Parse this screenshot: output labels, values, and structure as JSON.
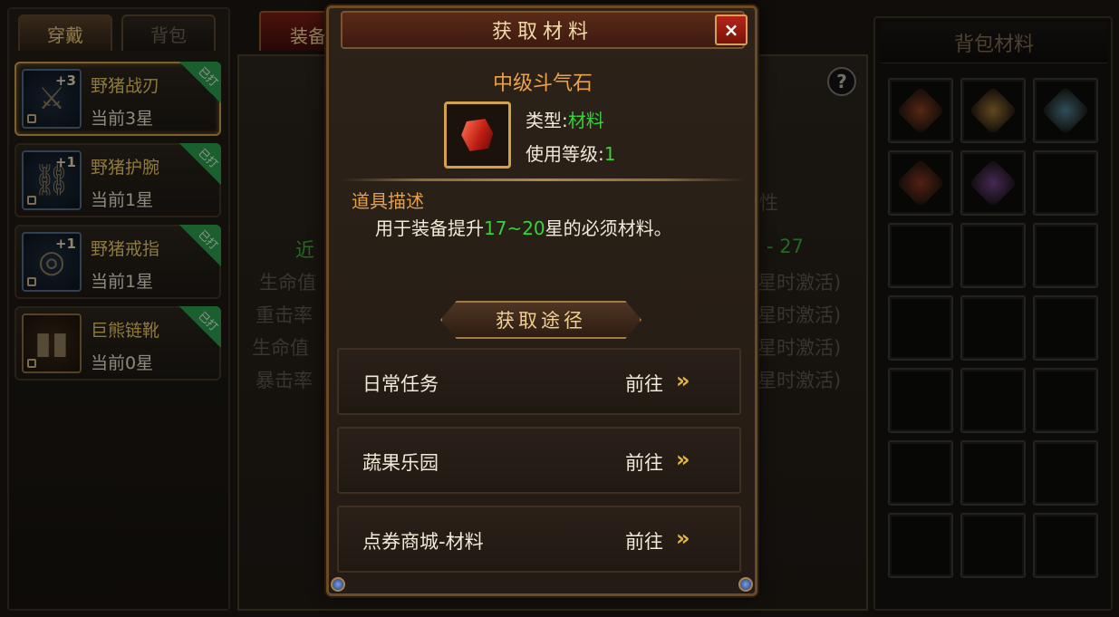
{
  "left_panel": {
    "tabs": [
      {
        "label": "穿戴"
      },
      {
        "label": "背包"
      }
    ],
    "items": [
      {
        "name": "野猪战刃",
        "star": "当前3星",
        "plus": "+3",
        "badge": "已打"
      },
      {
        "name": "野猪护腕",
        "star": "当前1星",
        "plus": "+1",
        "badge": "已打"
      },
      {
        "name": "野猪戒指",
        "star": "当前1星",
        "plus": "+1",
        "badge": "已打"
      },
      {
        "name": "巨熊链靴",
        "star": "当前0星",
        "plus": "",
        "badge": "已打"
      }
    ]
  },
  "middle_panel": {
    "tab_label": "装备",
    "help": "?",
    "bg_stats": [
      "近",
      "生命值",
      "重击率",
      "生命值",
      "暴击率"
    ],
    "bg_right": [
      "性",
      "- 27",
      "星时激活)",
      "星时激活)",
      "星时激活)",
      "星时激活)"
    ]
  },
  "right_panel": {
    "title": "背包材料",
    "slot_gems": [
      "#c0542a",
      "#d9a040",
      "#6ab0c8",
      "#b8482c",
      "#9a58c0"
    ]
  },
  "modal": {
    "title": "获取材料",
    "close": "×",
    "item_name": "中级斗气石",
    "type_label": "类型:",
    "type_value": "材料",
    "level_label": "使用等级:",
    "level_value": "1",
    "desc_title": "道具描述",
    "desc_prefix": "用于装备提升",
    "desc_highlight": "17~20",
    "desc_suffix": "星的必须材料。",
    "source_title": "获取途径",
    "routes": [
      {
        "name": "日常任务",
        "go": "前往"
      },
      {
        "name": "蔬果乐园",
        "go": "前往"
      },
      {
        "name": "点券商城-材料",
        "go": "前往"
      }
    ],
    "arrow": "»"
  }
}
